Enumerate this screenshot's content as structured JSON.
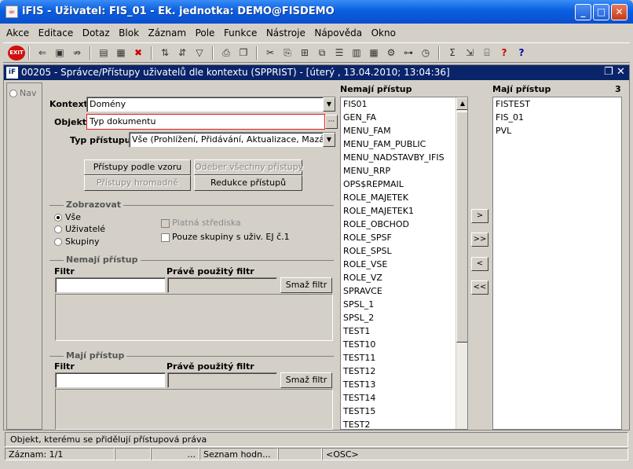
{
  "window": {
    "title": "iFIS - Uživatel: FIS_01 - Ek. jednotka: DEMO@FISDEMO",
    "controls": [
      "_",
      "□",
      "✕"
    ]
  },
  "menu": [
    "Akce",
    "Editace",
    "Dotaz",
    "Blok",
    "Záznam",
    "Pole",
    "Funkce",
    "Nástroje",
    "Nápověda",
    "Okno"
  ],
  "toolbar": {
    "exit_label": "EXIT",
    "icons": [
      "exit-icon",
      "first-record-icon",
      "save-icon",
      "delete-record-icon",
      "print-preview-icon",
      "query-icon",
      "cancel-query-icon",
      "sort-asc-icon",
      "sort-desc-icon",
      "filter-icon",
      "print-icon",
      "copy-icon",
      "cut-icon",
      "paste-icon",
      "insert-icon",
      "duplicate-icon",
      "list-icon",
      "columns-icon",
      "calendar-icon",
      "settings-icon",
      "tree-icon",
      "clock-icon",
      "sum-icon",
      "export-icon",
      "attach-icon",
      "help-icon",
      "context-help-icon"
    ]
  },
  "inner_window": {
    "title": "00205 - Správce/Přístupy uživatelů dle kontextu (SPPRIST) - [úterý , 13.04.2010; 13:04:36]",
    "nav_label": "Nav"
  },
  "form": {
    "kontext_label": "Kontext",
    "kontext_value": "Domény",
    "objekt_label": "Objekt",
    "objekt_value": "Typ dokumentu",
    "typ_pristupu_label": "Typ přístupu",
    "typ_pristupu_value": "Vše (Prohlížení, Přidávání, Aktualizace, Mazání)",
    "btn_pristupy_vzor": "Přístupy podle vzoru",
    "btn_odeber_vse": "Odeber všechny přístupy",
    "btn_pristupy_hromadne": "Přístupy hromadně",
    "btn_redukce": "Redukce přístupů"
  },
  "zobrazovat": {
    "title": "Zobrazovat",
    "options": [
      "Vše",
      "Uživatelé",
      "Skupiny"
    ],
    "selected": "Vše",
    "chk_platna": "Platná střediska",
    "chk_pouze_skupiny": "Pouze skupiny s uživ. EJ č.1"
  },
  "nemaji_filter": {
    "title": "Nemají přístup",
    "filtr_label": "Filtr",
    "pouzity_label": "Právě použitý filtr",
    "smaz_label": "Smaž filtr",
    "filtr_value": "",
    "pouzity_value": ""
  },
  "maji_filter": {
    "title": "Mají přístup",
    "filtr_label": "Filtr",
    "pouzity_label": "Právě použitý filtr",
    "smaz_label": "Smaž filtr",
    "filtr_value": "",
    "pouzity_value": ""
  },
  "nemaji_list": {
    "header": "Nemají přístup",
    "items": [
      "FIS01",
      "GEN_FA",
      "MENU_FAM",
      "MENU_FAM_PUBLIC",
      "MENU_NADSTAVBY_IFIS",
      "MENU_RRP",
      "OPS$REPMAIL",
      "ROLE_MAJETEK",
      "ROLE_MAJETEK1",
      "ROLE_OBCHOD",
      "ROLE_SPSF",
      "ROLE_SPSL",
      "ROLE_VSE",
      "ROLE_VZ",
      "SPRAVCE",
      "SPSL_1",
      "SPSL_2",
      "TEST1",
      "TEST10",
      "TEST11",
      "TEST12",
      "TEST13",
      "TEST14",
      "TEST15",
      "TEST2"
    ]
  },
  "move_buttons": [
    ">",
    ">>",
    "<",
    "<<"
  ],
  "maji_list": {
    "header": "Mají přístup",
    "count": "3",
    "items": [
      "FISTEST",
      "FIS_01",
      "PVL"
    ]
  },
  "status": {
    "hint": "Objekt, kterému se přidělují přístupová práva",
    "zaznam": "Záznam: 1/1",
    "ellipsis": "...",
    "seznam": "Seznam hodn...",
    "osc": "<OSC>"
  }
}
